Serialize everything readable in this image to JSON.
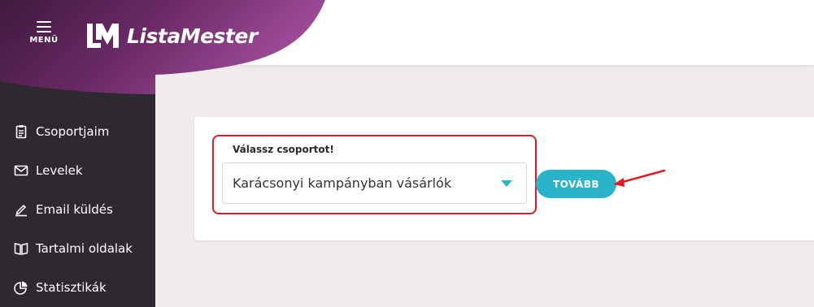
{
  "header": {
    "menu_label": "MENÜ",
    "logo_text": "ListaMester"
  },
  "sidebar": {
    "items": [
      {
        "label": "Csoportjaim",
        "icon": "clipboard-icon"
      },
      {
        "label": "Levelek",
        "icon": "envelope-icon"
      },
      {
        "label": "Email küldés",
        "icon": "pencil-icon"
      },
      {
        "label": "Tartalmi oldalak",
        "icon": "book-icon"
      },
      {
        "label": "Statisztikák",
        "icon": "pie-chart-icon"
      }
    ]
  },
  "form": {
    "label": "Válassz csoportot!",
    "selected": "Karácsonyi kampányban vásárlók",
    "next_label": "TOVÁBB"
  },
  "colors": {
    "accent": "#2ab4c9",
    "sidebar": "#2f2830",
    "brand_purple": "#8a3a86",
    "highlight": "#e01a22"
  }
}
